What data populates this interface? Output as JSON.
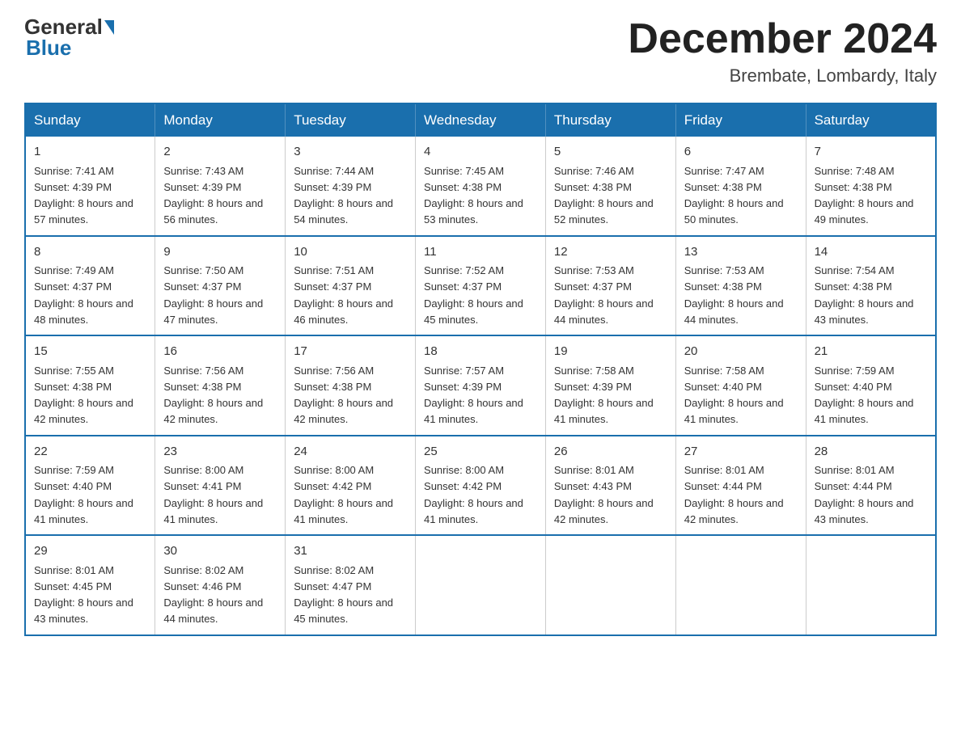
{
  "logo": {
    "general": "General",
    "blue": "Blue"
  },
  "title": "December 2024",
  "subtitle": "Brembate, Lombardy, Italy",
  "days_of_week": [
    "Sunday",
    "Monday",
    "Tuesday",
    "Wednesday",
    "Thursday",
    "Friday",
    "Saturday"
  ],
  "weeks": [
    [
      {
        "day": "1",
        "sunrise": "7:41 AM",
        "sunset": "4:39 PM",
        "daylight": "8 hours and 57 minutes."
      },
      {
        "day": "2",
        "sunrise": "7:43 AM",
        "sunset": "4:39 PM",
        "daylight": "8 hours and 56 minutes."
      },
      {
        "day": "3",
        "sunrise": "7:44 AM",
        "sunset": "4:39 PM",
        "daylight": "8 hours and 54 minutes."
      },
      {
        "day": "4",
        "sunrise": "7:45 AM",
        "sunset": "4:38 PM",
        "daylight": "8 hours and 53 minutes."
      },
      {
        "day": "5",
        "sunrise": "7:46 AM",
        "sunset": "4:38 PM",
        "daylight": "8 hours and 52 minutes."
      },
      {
        "day": "6",
        "sunrise": "7:47 AM",
        "sunset": "4:38 PM",
        "daylight": "8 hours and 50 minutes."
      },
      {
        "day": "7",
        "sunrise": "7:48 AM",
        "sunset": "4:38 PM",
        "daylight": "8 hours and 49 minutes."
      }
    ],
    [
      {
        "day": "8",
        "sunrise": "7:49 AM",
        "sunset": "4:37 PM",
        "daylight": "8 hours and 48 minutes."
      },
      {
        "day": "9",
        "sunrise": "7:50 AM",
        "sunset": "4:37 PM",
        "daylight": "8 hours and 47 minutes."
      },
      {
        "day": "10",
        "sunrise": "7:51 AM",
        "sunset": "4:37 PM",
        "daylight": "8 hours and 46 minutes."
      },
      {
        "day": "11",
        "sunrise": "7:52 AM",
        "sunset": "4:37 PM",
        "daylight": "8 hours and 45 minutes."
      },
      {
        "day": "12",
        "sunrise": "7:53 AM",
        "sunset": "4:37 PM",
        "daylight": "8 hours and 44 minutes."
      },
      {
        "day": "13",
        "sunrise": "7:53 AM",
        "sunset": "4:38 PM",
        "daylight": "8 hours and 44 minutes."
      },
      {
        "day": "14",
        "sunrise": "7:54 AM",
        "sunset": "4:38 PM",
        "daylight": "8 hours and 43 minutes."
      }
    ],
    [
      {
        "day": "15",
        "sunrise": "7:55 AM",
        "sunset": "4:38 PM",
        "daylight": "8 hours and 42 minutes."
      },
      {
        "day": "16",
        "sunrise": "7:56 AM",
        "sunset": "4:38 PM",
        "daylight": "8 hours and 42 minutes."
      },
      {
        "day": "17",
        "sunrise": "7:56 AM",
        "sunset": "4:38 PM",
        "daylight": "8 hours and 42 minutes."
      },
      {
        "day": "18",
        "sunrise": "7:57 AM",
        "sunset": "4:39 PM",
        "daylight": "8 hours and 41 minutes."
      },
      {
        "day": "19",
        "sunrise": "7:58 AM",
        "sunset": "4:39 PM",
        "daylight": "8 hours and 41 minutes."
      },
      {
        "day": "20",
        "sunrise": "7:58 AM",
        "sunset": "4:40 PM",
        "daylight": "8 hours and 41 minutes."
      },
      {
        "day": "21",
        "sunrise": "7:59 AM",
        "sunset": "4:40 PM",
        "daylight": "8 hours and 41 minutes."
      }
    ],
    [
      {
        "day": "22",
        "sunrise": "7:59 AM",
        "sunset": "4:40 PM",
        "daylight": "8 hours and 41 minutes."
      },
      {
        "day": "23",
        "sunrise": "8:00 AM",
        "sunset": "4:41 PM",
        "daylight": "8 hours and 41 minutes."
      },
      {
        "day": "24",
        "sunrise": "8:00 AM",
        "sunset": "4:42 PM",
        "daylight": "8 hours and 41 minutes."
      },
      {
        "day": "25",
        "sunrise": "8:00 AM",
        "sunset": "4:42 PM",
        "daylight": "8 hours and 41 minutes."
      },
      {
        "day": "26",
        "sunrise": "8:01 AM",
        "sunset": "4:43 PM",
        "daylight": "8 hours and 42 minutes."
      },
      {
        "day": "27",
        "sunrise": "8:01 AM",
        "sunset": "4:44 PM",
        "daylight": "8 hours and 42 minutes."
      },
      {
        "day": "28",
        "sunrise": "8:01 AM",
        "sunset": "4:44 PM",
        "daylight": "8 hours and 43 minutes."
      }
    ],
    [
      {
        "day": "29",
        "sunrise": "8:01 AM",
        "sunset": "4:45 PM",
        "daylight": "8 hours and 43 minutes."
      },
      {
        "day": "30",
        "sunrise": "8:02 AM",
        "sunset": "4:46 PM",
        "daylight": "8 hours and 44 minutes."
      },
      {
        "day": "31",
        "sunrise": "8:02 AM",
        "sunset": "4:47 PM",
        "daylight": "8 hours and 45 minutes."
      },
      null,
      null,
      null,
      null
    ]
  ],
  "labels": {
    "sunrise": "Sunrise:",
    "sunset": "Sunset:",
    "daylight": "Daylight:"
  }
}
